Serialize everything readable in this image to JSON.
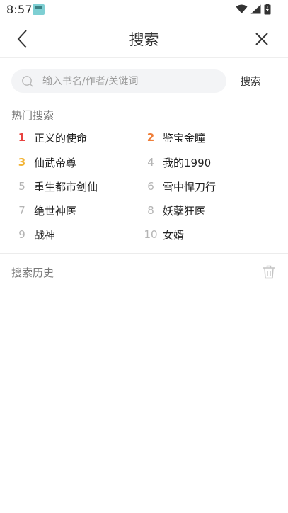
{
  "status_bar": {
    "time": "8:57",
    "icons": [
      "app-notification-icon",
      "wifi-icon",
      "signal-icon",
      "battery-charging-icon"
    ]
  },
  "nav": {
    "title": "搜索",
    "back_icon": "chevron-left-icon",
    "close_icon": "close-icon"
  },
  "search": {
    "placeholder": "输入书名/作者/关键词",
    "value": "",
    "button_label": "搜索",
    "icon": "search-icon"
  },
  "hot_search": {
    "title": "热门搜索",
    "items": [
      {
        "rank": "1",
        "name": "正义的使命"
      },
      {
        "rank": "2",
        "name": "鉴宝金瞳"
      },
      {
        "rank": "3",
        "name": "仙武帝尊"
      },
      {
        "rank": "4",
        "name": "我的1990"
      },
      {
        "rank": "5",
        "name": "重生都市剑仙"
      },
      {
        "rank": "6",
        "name": "雪中悍刀行"
      },
      {
        "rank": "7",
        "name": "绝世神医"
      },
      {
        "rank": "8",
        "name": "妖孽狂医"
      },
      {
        "rank": "9",
        "name": "战神"
      },
      {
        "rank": "10",
        "name": "女婿"
      }
    ],
    "rank_colors": {
      "first": "#e8423f",
      "second": "#ef7f3a",
      "third": "#f2b437",
      "other": "#b4b4b4"
    }
  },
  "history": {
    "title": "搜索历史",
    "clear_icon": "trash-icon",
    "items": []
  }
}
